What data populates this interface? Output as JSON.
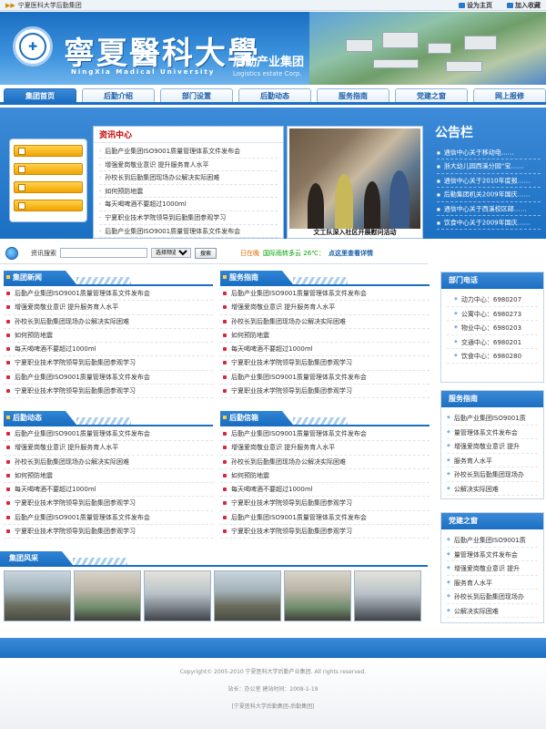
{
  "topbar": {
    "title": "宁夏医科大学后勤集团",
    "set_home": "设为主页",
    "favorite": "加入收藏"
  },
  "header": {
    "cn_name": "寧夏醫科大學",
    "en_name": "NingXia Madical University",
    "sub_cn": "后勤产业集团",
    "sub_en": "Logistics estate Corp."
  },
  "nav": {
    "tabs": [
      "集团首页",
      "后勤介绍",
      "部门设置",
      "后勤动态",
      "服务指南",
      "党建之窗",
      "网上报修"
    ]
  },
  "news_center": {
    "title": "资讯中心",
    "items": [
      "后勤产业集团ISO9001质量管理体系文件发布会",
      "增强爱岗敬业意识 提升服务育人水平",
      "孙校长到后勤集团现场办公解决实际困难",
      "如何预防地震",
      "每天喝啤酒不要超过1000ml",
      "宁夏职业技术学院领导到后勤集团参观学习",
      "后勤产业集团ISO9001质量管理体系文件发布会"
    ]
  },
  "photo": {
    "caption": "文工队深入社区开展慰问活动"
  },
  "notice": {
    "title": "公告栏",
    "items": [
      "通信中心关于移动电……",
      "浙大幼儿园西溪分园“宝……",
      "通信中心关于2010年度报……",
      "后勤集团机关2009年国庆……",
      "通信中心关于西溪校区邮……",
      "饮食中心关于2009年国庆……"
    ]
  },
  "search": {
    "label": "资讯搜索",
    "placeholder": "",
    "select": "选择频道",
    "button": "搜索",
    "calendar": "日在晚",
    "weather": "国际雨转多云 26℃：",
    "more": "点这里查看详情"
  },
  "sections": {
    "group_news": {
      "title": "集团新闻",
      "items": [
        "后勤产业集团ISO9001质量管理体系文件发布会",
        "增强爱岗敬业意识 提升服务育人水平",
        "孙校长到后勤集团现场办公解决实际困难",
        "如何预防地震",
        "每天喝啤酒不要超过1000ml",
        "宁夏职业技术学院领导到后勤集团参观学习",
        "后勤产业集团ISO9001质量管理体系文件发布会",
        "宁夏职业技术学院领导到后勤集团参观学习"
      ]
    },
    "service_guide": {
      "title": "服务指南",
      "items": [
        "后勤产业集团ISO9001质量管理体系文件发布会",
        "增强爱岗敬业意识 提升服务育人水平",
        "孙校长到后勤集团现场办公解决实际困难",
        "如何预防地震",
        "每天喝啤酒不要超过1000ml",
        "宁夏职业技术学院领导到后勤集团参观学习",
        "后勤产业集团ISO9001质量管理体系文件发布会",
        "宁夏职业技术学院领导到后勤集团参观学习"
      ]
    },
    "logistics_news": {
      "title": "后勤动态",
      "items": [
        "后勤产业集团ISO9001质量管理体系文件发布会",
        "增强爱岗敬业意识 提升服务育人水平",
        "孙校长到后勤集团现场办公解决实际困难",
        "如何预防地震",
        "每天喝啤酒不要超过1000ml",
        "宁夏职业技术学院领导到后勤集团参观学习",
        "后勤产业集团ISO9001质量管理体系文件发布会",
        "宁夏职业技术学院领导到后勤集团参观学习"
      ]
    },
    "logistics_info": {
      "title": "后勤信箱",
      "items": [
        "后勤产业集团ISO9001质量管理体系文件发布会",
        "增强爱岗敬业意识 提升服务育人水平",
        "孙校长到后勤集团现场办公解决实际困难",
        "如何预防地震",
        "每天喝啤酒不要超过1000ml",
        "宁夏职业技术学院领导到后勤集团参观学习",
        "后勤产业集团ISO9001质量管理体系文件发布会",
        "宁夏职业技术学院领导到后勤集团参观学习"
      ]
    }
  },
  "sidebar": {
    "phone": {
      "title": "部门电话",
      "items": [
        "动力中心：6980207",
        "公寓中心：6980273",
        "物业中心：6980203",
        "交通中心：6980201",
        "饮食中心：6980280"
      ]
    },
    "guide": {
      "title": "服务指南",
      "items": [
        "后勤产业集团ISO9001质",
        "量管理体系文件发布会",
        "增强爱岗敬业意识 提升",
        "服务育人水平",
        "孙校长到后勤集团现场办",
        "公解决实际困难"
      ]
    },
    "party": {
      "title": "党建之窗",
      "items": [
        "后勤产业集团ISO9001质",
        "量管理体系文件发布会",
        "增强爱岗敬业意识 提升",
        "服务育人水平",
        "孙校长到后勤集团现场办",
        "公解决实际困难"
      ]
    }
  },
  "gallery": {
    "title": "集团风采"
  },
  "footer": {
    "copyright": "Copyright© 2005-2010 宁夏医科大学后勤产业集团. All rights reserved.",
    "info": "站长：办公室 建站时间：2008-1-19",
    "name": "[宁夏医科大学后勤集团-后勤集团]"
  }
}
